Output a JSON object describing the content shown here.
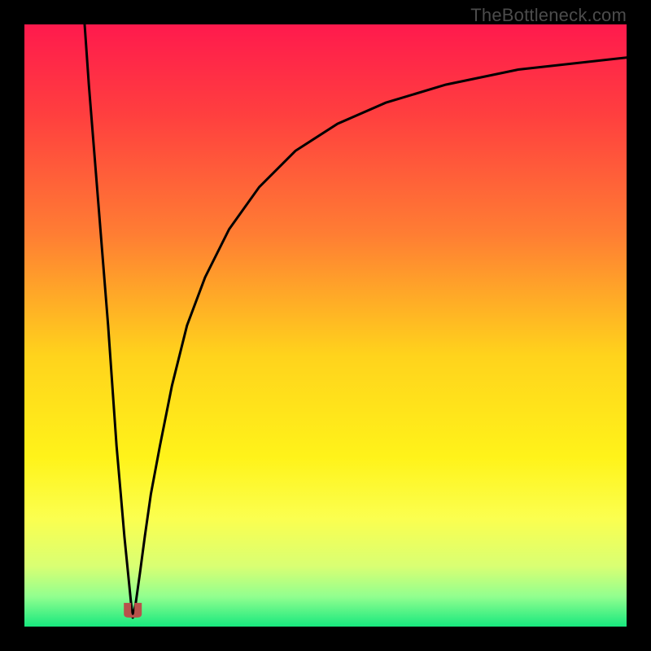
{
  "watermark": "TheBottleneck.com",
  "chart_data": {
    "type": "line",
    "title": "",
    "xlabel": "",
    "ylabel": "",
    "xlim": [
      0,
      100
    ],
    "ylim": [
      0,
      100
    ],
    "gradient_stops": [
      {
        "pos": 0,
        "color": "#ff1a4d"
      },
      {
        "pos": 15,
        "color": "#ff3f3f"
      },
      {
        "pos": 35,
        "color": "#ff7e33"
      },
      {
        "pos": 55,
        "color": "#ffd31c"
      },
      {
        "pos": 72,
        "color": "#fff31a"
      },
      {
        "pos": 82,
        "color": "#fbff4f"
      },
      {
        "pos": 90,
        "color": "#d9ff73"
      },
      {
        "pos": 95,
        "color": "#92ff8f"
      },
      {
        "pos": 100,
        "color": "#17e87e"
      }
    ],
    "min_marker": {
      "x": 18,
      "y": 1.5,
      "color": "#b8524b"
    },
    "series": [
      {
        "name": "left-branch",
        "x": [
          10.0,
          10.7,
          11.5,
          12.3,
          13.1,
          13.9,
          14.6,
          15.3,
          16.0,
          16.6,
          17.2,
          17.7,
          18.0
        ],
        "values": [
          100.0,
          90.0,
          80.0,
          70.0,
          60.0,
          50.0,
          40.0,
          30.0,
          22.0,
          15.0,
          9.0,
          4.0,
          1.5
        ]
      },
      {
        "name": "right-branch",
        "x": [
          18.0,
          18.5,
          19.2,
          20.0,
          21.0,
          22.5,
          24.5,
          27.0,
          30.0,
          34.0,
          39.0,
          45.0,
          52.0,
          60.0,
          70.0,
          82.0,
          100.0
        ],
        "values": [
          1.5,
          4.0,
          9.0,
          15.0,
          22.0,
          30.0,
          40.0,
          50.0,
          58.0,
          66.0,
          73.0,
          79.0,
          83.5,
          87.0,
          90.0,
          92.5,
          94.5
        ]
      }
    ]
  }
}
